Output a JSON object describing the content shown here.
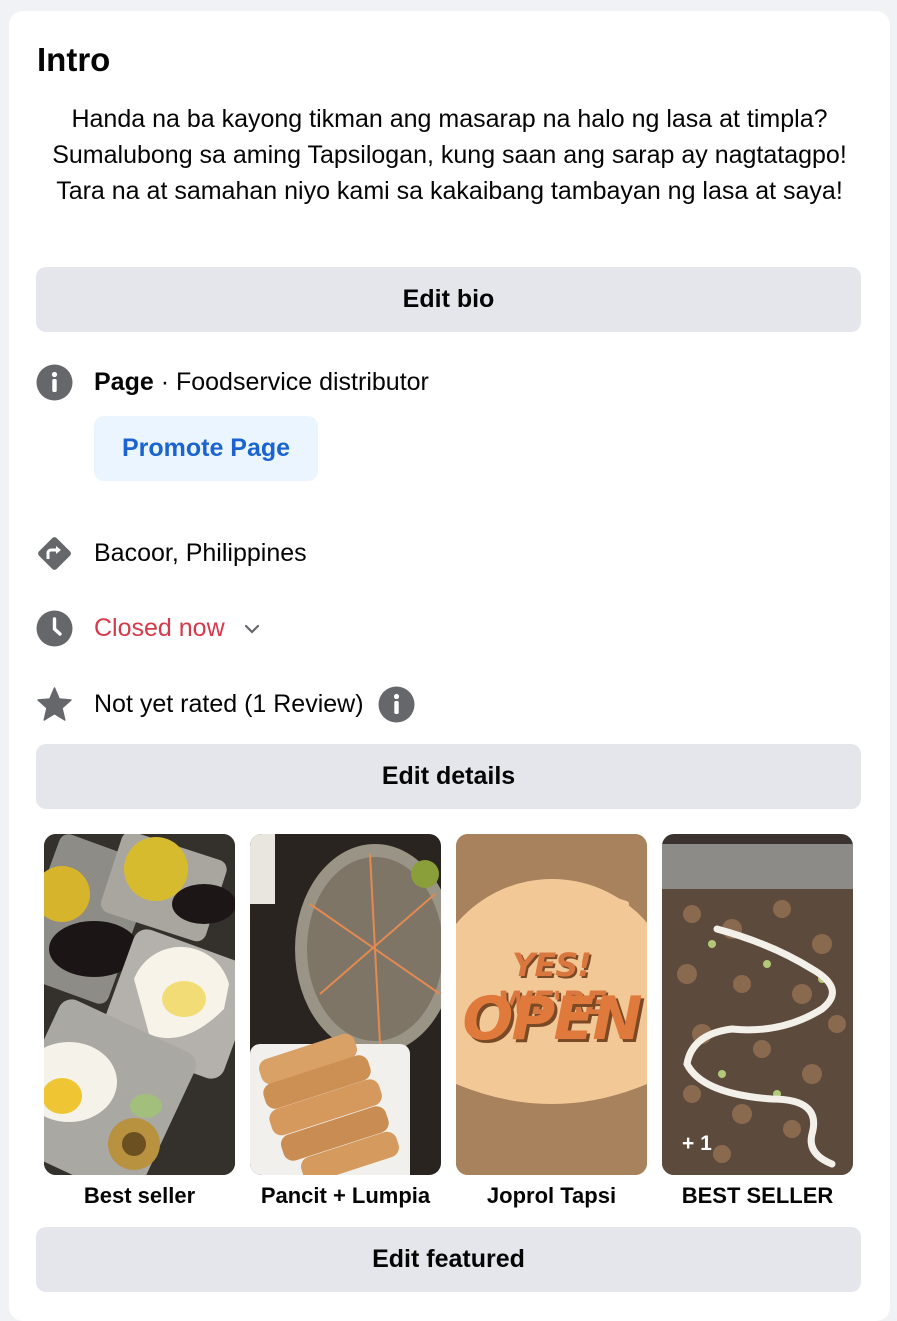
{
  "intro": {
    "title": "Intro",
    "bio": "Handa na ba kayong tikman ang masarap na halo ng lasa at timpla? Sumalubong sa aming Tapsilogan, kung saan ang sarap ay nagtatagpo! Tara na at samahan niyo kami sa kakaibang tambayan ng lasa at saya!",
    "edit_bio_label": "Edit bio"
  },
  "details": {
    "page_label": "Page",
    "category": " · Foodservice distributor",
    "promote_label": "Promote Page",
    "location": "Bacoor, Philippines",
    "hours_status": "Closed now",
    "rating": "Not yet rated (1 Review)",
    "edit_details_label": "Edit details"
  },
  "featured": {
    "items": [
      {
        "label": "Best seller"
      },
      {
        "label": "Pancit + Lumpia"
      },
      {
        "label": "Joprol Tapsi",
        "poster_line1": "YES! WE'RE",
        "poster_line2": "OPEN"
      },
      {
        "label": "BEST SELLER",
        "extra_count": "+ 1"
      }
    ],
    "edit_featured_label": "Edit featured"
  },
  "colors": {
    "accent": "#1b64d0",
    "closed": "#d63a4a",
    "icon_gray": "#65676b"
  }
}
